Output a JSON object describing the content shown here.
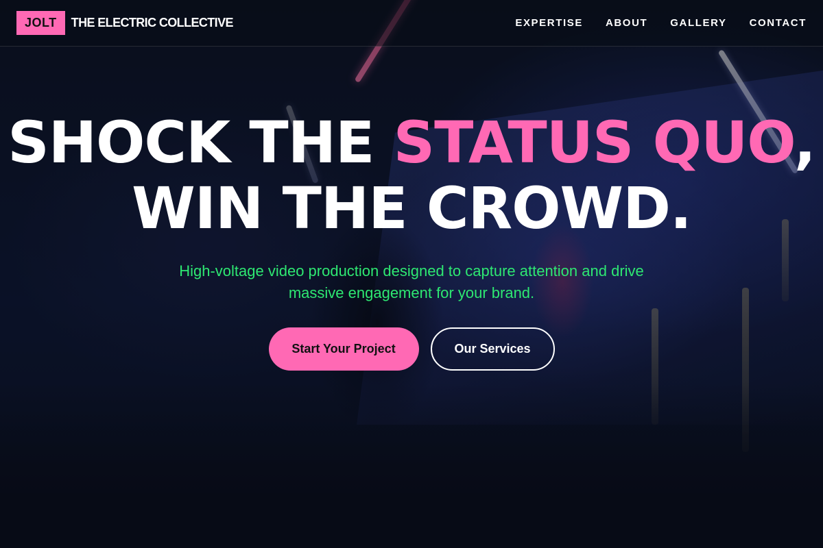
{
  "header": {
    "logo_text": "JOLT",
    "brand_name": "THE ELECTRIC COLLECTIVE",
    "nav": [
      "EXPERTISE",
      "ABOUT",
      "GALLERY",
      "CONTACT"
    ]
  },
  "hero": {
    "headline": {
      "part1": "SHOCK THE ",
      "highlight": "STATUS QUO",
      "part2": ",",
      "line2": "WIN THE CROWD."
    },
    "subtitle": "High-voltage video production designed to capture attention and drive massive engagement for your brand.",
    "primary_cta": "Start Your Project",
    "secondary_cta": "Our Services"
  },
  "colors": {
    "accent_pink": "#ff69b4",
    "accent_green": "#2ee872",
    "background": "#0b1220"
  }
}
